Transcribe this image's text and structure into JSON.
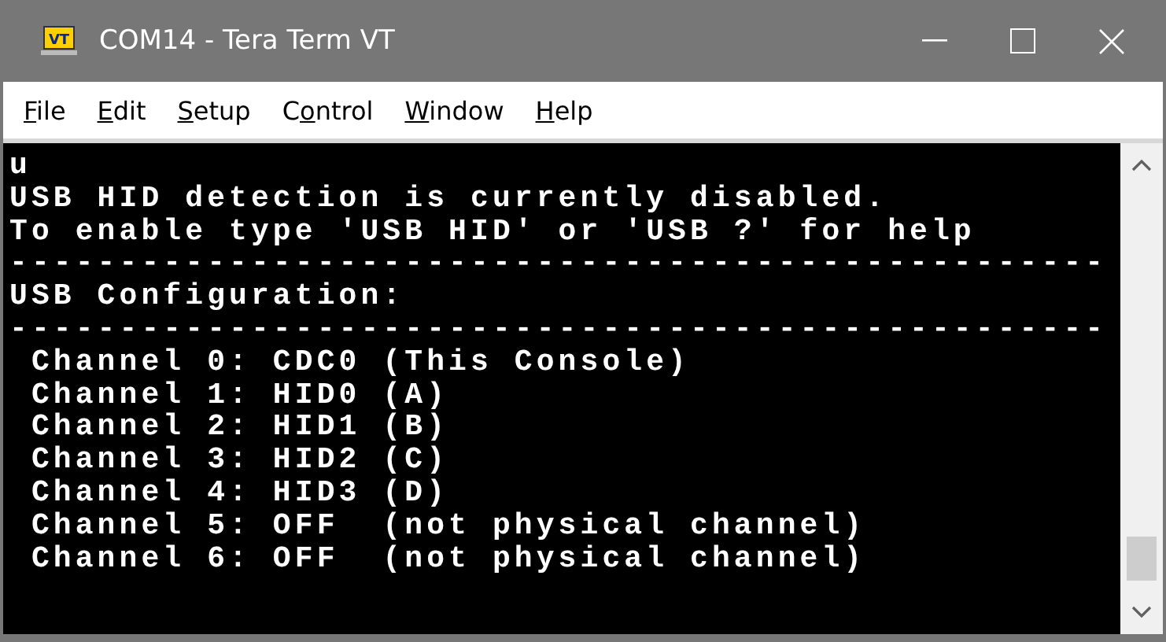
{
  "window": {
    "icon_text": "VT",
    "title": "COM14 - Tera Term VT"
  },
  "menu": [
    {
      "underlined": "F",
      "after": "ile"
    },
    {
      "underlined": "E",
      "after": "dit"
    },
    {
      "underlined": "S",
      "after": "etup"
    },
    {
      "before": "C",
      "underlined": "o",
      "after": "ntrol"
    },
    {
      "underlined": "W",
      "after": "indow"
    },
    {
      "underlined": "H",
      "after": "elp"
    }
  ],
  "terminal": {
    "lines": [
      "u",
      "USB HID detection is currently disabled.",
      "To enable type 'USB HID' or 'USB ?' for help",
      "--------------------------------------------------",
      "USB Configuration:",
      "--------------------------------------------------",
      " Channel 0: CDC0 (This Console)",
      " Channel 1: HID0 (A)",
      " Channel 2: HID1 (B)",
      " Channel 3: HID2 (C)",
      " Channel 4: HID3 (D)",
      " Channel 5: OFF  (not physical channel)",
      " Channel 6: OFF  (not physical channel)"
    ]
  }
}
